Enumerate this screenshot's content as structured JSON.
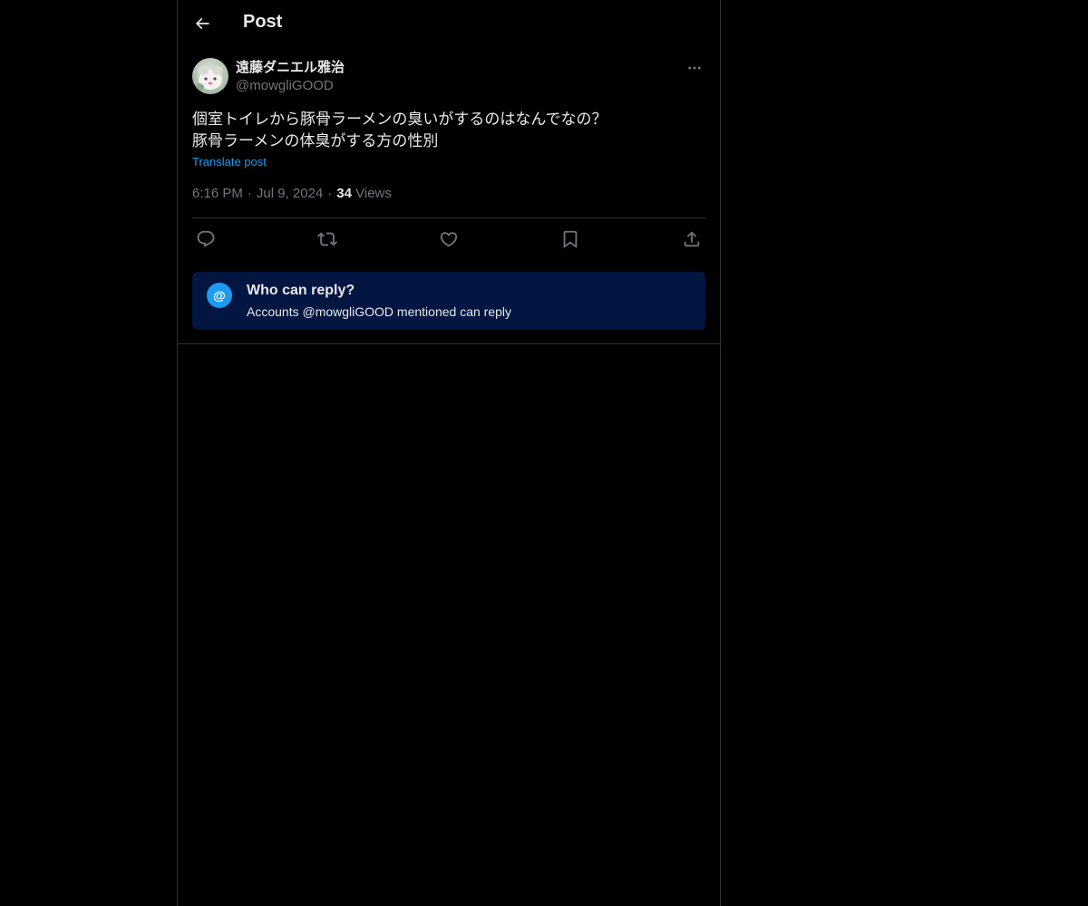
{
  "header": {
    "title": "Post",
    "back_icon": "arrow-left-icon"
  },
  "post": {
    "author": {
      "display_name": "遠藤ダニエル雅治",
      "handle": "@mowgliGOOD",
      "avatar_icon": "avatar-image"
    },
    "more_icon": "ellipsis-icon",
    "text_lines": [
      "個室トイレから豚骨ラーメンの臭いがするのはなんでなの？",
      "豚骨ラーメンの体臭がする方の性別"
    ],
    "translate_label": "Translate post",
    "time": "6:16 PM",
    "date": "Jul 9, 2024",
    "separator": "·",
    "views_count": "34",
    "views_label": "Views"
  },
  "actions": [
    {
      "name": "reply",
      "icon": "reply-icon"
    },
    {
      "name": "repost",
      "icon": "repost-icon"
    },
    {
      "name": "like",
      "icon": "heart-icon"
    },
    {
      "name": "bookmark",
      "icon": "bookmark-icon"
    },
    {
      "name": "share",
      "icon": "share-icon"
    }
  ],
  "reply_notice": {
    "icon_glyph": "@",
    "title": "Who can reply?",
    "subtitle": "Accounts @mowgliGOOD mentioned can reply"
  },
  "colors": {
    "background": "#000000",
    "text": "#e7e9ea",
    "muted": "#71767b",
    "accent": "#1d9bf0",
    "border": "#2f3336",
    "notice_bg": "#031541"
  }
}
